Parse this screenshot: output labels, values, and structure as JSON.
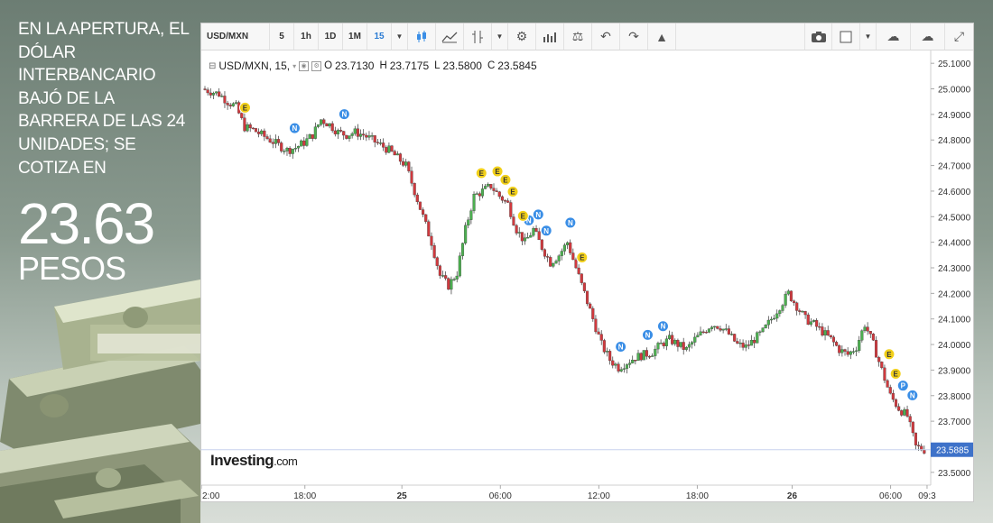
{
  "headline": {
    "lines": [
      "EN LA APERTURA, EL",
      "DÓLAR",
      "INTERBANCARIO",
      "BAJÓ DE LA",
      "BARRERA DE LAS 24",
      "UNIDADES; SE",
      "COTIZA EN"
    ],
    "value": "23.63",
    "unit": "PESOS"
  },
  "toolbar": {
    "symbol": "USD/MXN",
    "intervals": [
      "5",
      "1h",
      "1D",
      "1M",
      "15"
    ],
    "active_interval": "15"
  },
  "legend": {
    "title": "USD/MXN, 15,",
    "o_label": "O",
    "o": "23.7130",
    "h_label": "H",
    "h": "23.7175",
    "l_label": "L",
    "l": "23.5800",
    "c_label": "C",
    "c": "23.5845"
  },
  "brand": {
    "name": "Investing",
    "suffix": ".com"
  },
  "colors": {
    "up": "#4caf50",
    "down": "#d0393e",
    "event_E": "#f2d019",
    "event_N": "#3a8ee6",
    "last_price_bg": "#3e72c9"
  },
  "chart_data": {
    "type": "candlestick",
    "title": "USD/MXN, 15",
    "ylim": [
      23.45,
      25.15
    ],
    "y_ticks": [
      "25.1000",
      "25.0000",
      "24.9000",
      "24.8000",
      "24.7000",
      "24.6000",
      "24.5000",
      "24.4000",
      "24.3000",
      "24.2000",
      "24.1000",
      "24.0000",
      "23.9000",
      "23.8000",
      "23.7000",
      "23.6000",
      "23.5000"
    ],
    "x_ticks": [
      "2:00",
      "18:00",
      "25",
      "06:00",
      "12:00",
      "18:00",
      "26",
      "06:00",
      "09:3"
    ],
    "last_price": "23.5885",
    "close_path": [
      25.0,
      24.99,
      24.98,
      24.95,
      24.93,
      24.85,
      24.84,
      24.82,
      24.8,
      24.78,
      24.76,
      24.77,
      24.79,
      24.82,
      24.88,
      24.86,
      24.83,
      24.82,
      24.83,
      24.82,
      24.8,
      24.78,
      24.76,
      24.73,
      24.7,
      24.6,
      24.5,
      24.4,
      24.27,
      24.23,
      24.28,
      24.45,
      24.58,
      24.6,
      24.62,
      24.58,
      24.55,
      24.45,
      24.4,
      24.45,
      24.38,
      24.32,
      24.35,
      24.4,
      24.3,
      24.2,
      24.1,
      24.0,
      23.94,
      23.91,
      23.93,
      23.95,
      23.96,
      23.97,
      24.0,
      24.02,
      24.0,
      23.98,
      24.02,
      24.05,
      24.08,
      24.07,
      24.04,
      24.0,
      23.99,
      24.02,
      24.05,
      24.1,
      24.15,
      24.2,
      24.15,
      24.1,
      24.08,
      24.05,
      24.02,
      23.98,
      23.96,
      23.99,
      24.08,
      24.0,
      23.9,
      23.8,
      23.75,
      23.72,
      23.6,
      23.5885
    ],
    "events": [
      {
        "label": "E",
        "x": 0.06
      },
      {
        "label": "N",
        "x": 0.128
      },
      {
        "label": "N",
        "x": 0.196
      },
      {
        "label": "E",
        "x": 0.384
      },
      {
        "label": "E",
        "x": 0.406
      },
      {
        "label": "E",
        "x": 0.417
      },
      {
        "label": "E",
        "x": 0.427
      },
      {
        "label": "N",
        "x": 0.441
      },
      {
        "label": "N",
        "x": 0.449
      },
      {
        "label": "E",
        "x": 0.441
      },
      {
        "label": "N",
        "x": 0.462
      },
      {
        "label": "N",
        "x": 0.473
      },
      {
        "label": "N",
        "x": 0.506
      },
      {
        "label": "E",
        "x": 0.522
      },
      {
        "label": "N",
        "x": 0.575
      },
      {
        "label": "N",
        "x": 0.612
      },
      {
        "label": "N",
        "x": 0.633
      },
      {
        "label": "E",
        "x": 0.943
      },
      {
        "label": "E",
        "x": 0.952
      },
      {
        "label": "P",
        "x": 0.962
      },
      {
        "label": "N",
        "x": 0.975
      }
    ]
  }
}
